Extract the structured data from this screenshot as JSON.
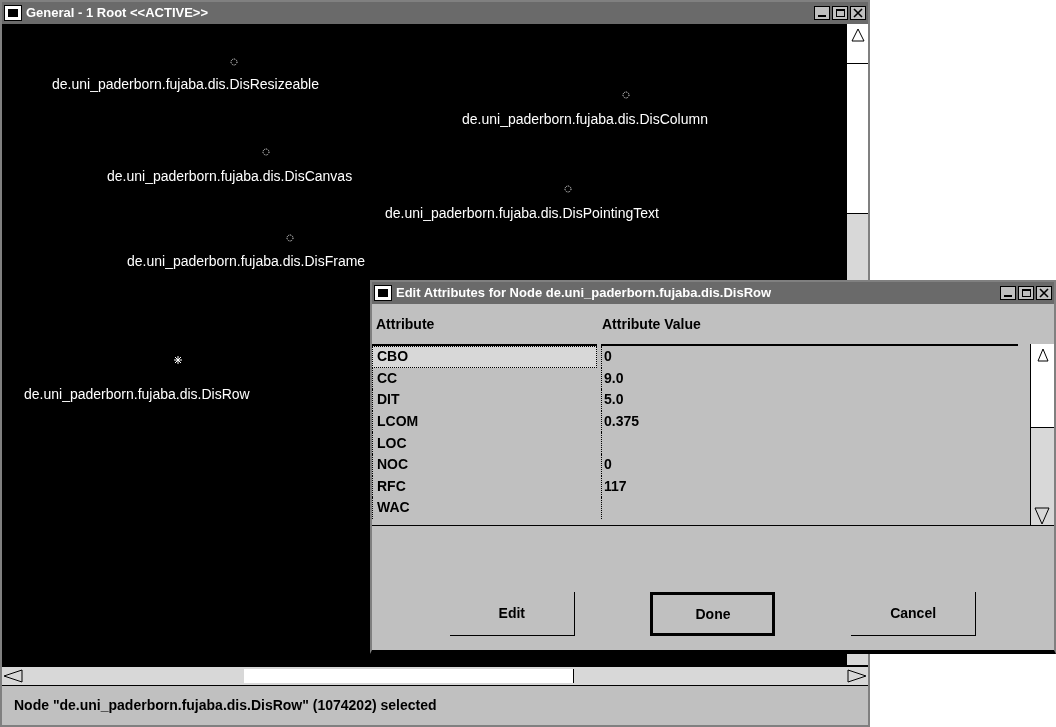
{
  "main_window": {
    "title": "General - 1 Root <<ACTIVE>>"
  },
  "canvas": {
    "nodes": [
      {
        "label": "de.uni_paderborn.fujaba.dis.DisResizeable",
        "selected": false
      },
      {
        "label": "de.uni_paderborn.fujaba.dis.DisColumn",
        "selected": false
      },
      {
        "label": "de.uni_paderborn.fujaba.dis.DisCanvas",
        "selected": false
      },
      {
        "label": "de.uni_paderborn.fujaba.dis.DisPointingText",
        "selected": false
      },
      {
        "label": "de.uni_paderborn.fujaba.dis.DisFrame",
        "selected": false
      },
      {
        "label": "de.uni_paderborn.fujaba.dis.DisRow",
        "selected": true
      }
    ]
  },
  "status_bar": "Node \"de.uni_paderborn.fujaba.dis.DisRow\" (1074202) selected",
  "dialog": {
    "title": "Edit Attributes for Node de.uni_paderborn.fujaba.dis.DisRow",
    "columns": [
      "Attribute",
      "Attribute Value"
    ],
    "rows": [
      {
        "attribute": "CBO",
        "value": "0",
        "selected": true
      },
      {
        "attribute": "CC",
        "value": "9.0",
        "selected": false
      },
      {
        "attribute": "DIT",
        "value": "5.0",
        "selected": false
      },
      {
        "attribute": "LCOM",
        "value": "0.375",
        "selected": false
      },
      {
        "attribute": "LOC",
        "selected": false
      },
      {
        "attribute": "NOC",
        "value": "0",
        "selected": false
      },
      {
        "attribute": "RFC",
        "value": "117",
        "selected": false
      },
      {
        "attribute": "WAC",
        "selected": false
      }
    ],
    "buttons": [
      {
        "label": "Edit",
        "default": false
      },
      {
        "label": "Done",
        "default": true
      },
      {
        "label": "Cancel",
        "default": false
      }
    ]
  }
}
